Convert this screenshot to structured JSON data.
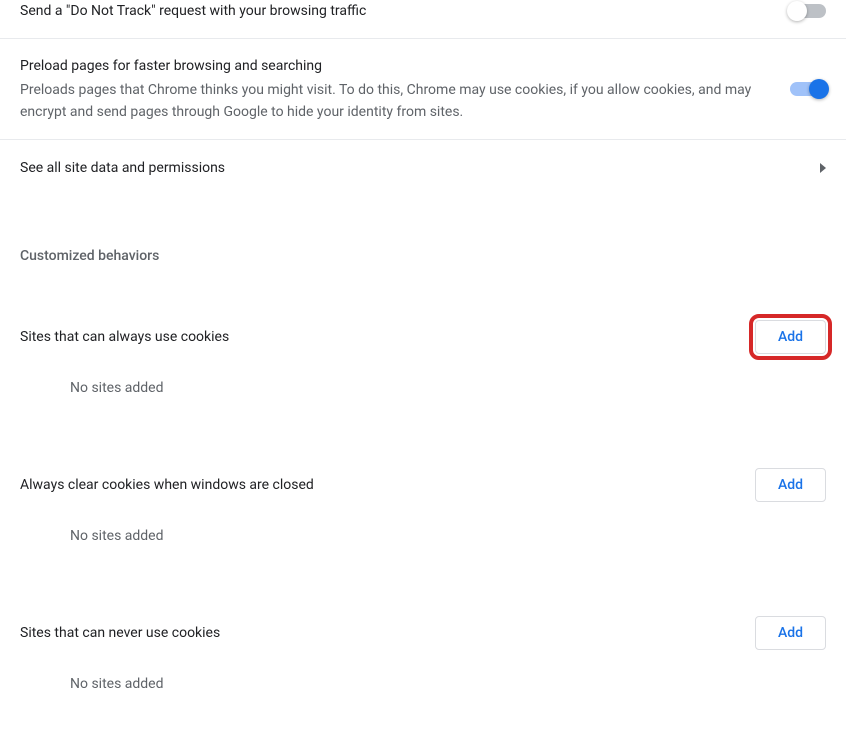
{
  "dnt": {
    "title": "Send a \"Do Not Track\" request with your browsing traffic",
    "enabled": false
  },
  "preload": {
    "title": "Preload pages for faster browsing and searching",
    "desc": "Preloads pages that Chrome thinks you might visit. To do this, Chrome may use cookies, if you allow cookies, and may encrypt and send pages through Google to hide your identity from sites.",
    "enabled": true
  },
  "site_data_link": "See all site data and permissions",
  "section_header": "Customized behaviors",
  "behaviors": {
    "always_allow": {
      "title": "Sites that can always use cookies",
      "add_label": "Add",
      "empty": "No sites added"
    },
    "clear_on_close": {
      "title": "Always clear cookies when windows are closed",
      "add_label": "Add",
      "empty": "No sites added"
    },
    "never_allow": {
      "title": "Sites that can never use cookies",
      "add_label": "Add",
      "empty": "No sites added"
    }
  }
}
